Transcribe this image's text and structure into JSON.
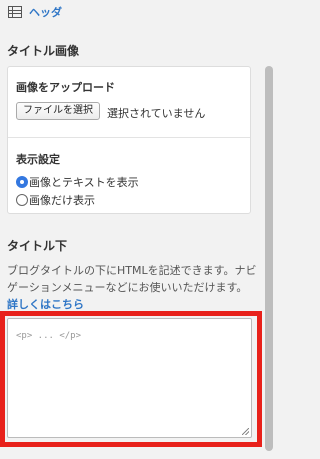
{
  "header": {
    "icon": "table-icon",
    "label": "ヘッダ"
  },
  "title_image": {
    "section_title": "タイトル画像",
    "upload_title": "画像をアップロード",
    "file_button_label": "ファイルを選択",
    "file_status": "選択されていません",
    "display_title": "表示設定",
    "options": [
      {
        "label": "画像とテキストを表示",
        "checked": true
      },
      {
        "label": "画像だけ表示",
        "checked": false
      }
    ]
  },
  "below_title": {
    "section_title": "タイトル下",
    "description": "ブログタイトルの下にHTMLを記述できます。ナビゲーションメニューなどにお使いいただけます。",
    "link_text": "詳しくはこちら",
    "textarea_placeholder": "<p> ... </p>"
  },
  "colors": {
    "accent": "#2f76c6",
    "highlight": "#e8211b"
  }
}
